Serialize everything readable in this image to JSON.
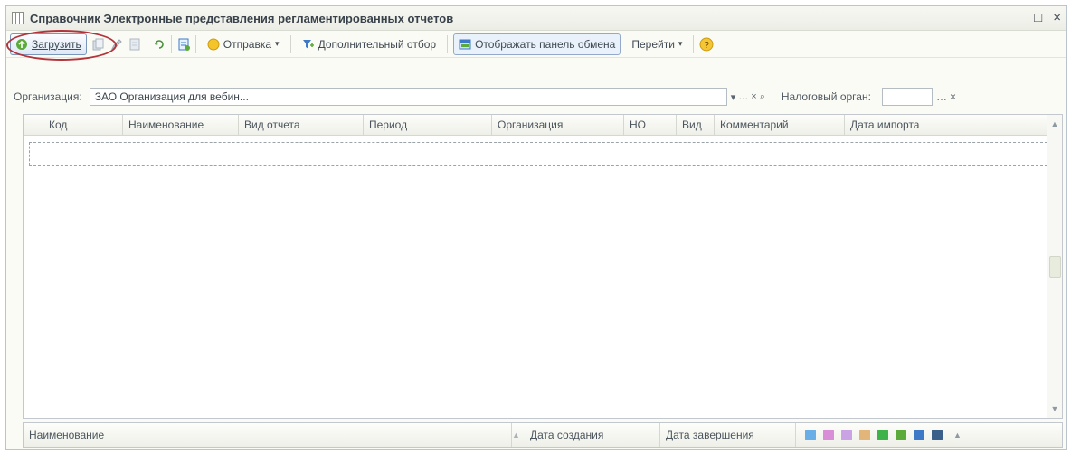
{
  "window": {
    "title": "Справочник Электронные представления регламентированных отчетов",
    "controls": [
      "_",
      "□",
      "×"
    ]
  },
  "toolbar": {
    "load_label": "Загрузить",
    "send_label": "Отправка",
    "extra_filter_label": "Дополнительный отбор",
    "show_exchange_label": "Отображать панель обмена",
    "goto_label": "Перейти",
    "help_label": "?"
  },
  "filters": {
    "org_label": "Организация:",
    "org_value": "ЗАО Организация для вебин...",
    "tax_label": "Налоговый орган:",
    "tax_value": ""
  },
  "grid": {
    "columns": [
      "Код",
      "Наименование",
      "Вид отчета",
      "Период",
      "Организация",
      "НО",
      "Вид",
      "Комментарий",
      "Дата импорта"
    ]
  },
  "subgrid": {
    "columns": [
      "Наименование",
      "Дата создания",
      "Дата завершения"
    ]
  },
  "colors": {
    "accent": "#3d79c6",
    "annotation_circle": "#b3333b"
  }
}
